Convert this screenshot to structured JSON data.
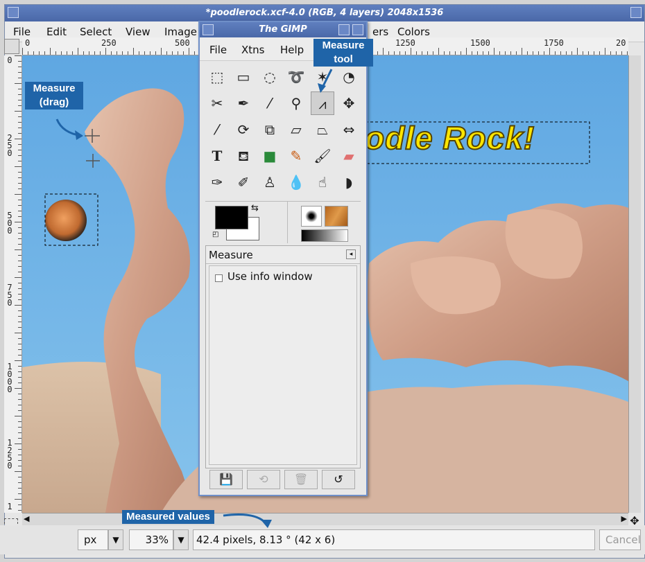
{
  "image_window": {
    "title": "*poodlerock.xcf-4.0 (RGB, 4 layers) 2048x1536",
    "menu": [
      "File",
      "Edit",
      "Select",
      "View",
      "Image",
      "ers",
      "Colors"
    ],
    "hruler_labels": [
      "0",
      "250",
      "500",
      "1250",
      "1500",
      "1750",
      "20"
    ],
    "vruler_labels": [
      "0",
      "250",
      "500",
      "750",
      "1000",
      "1250",
      "1"
    ],
    "image_text": "odle Rock!",
    "status": {
      "unit": "px",
      "zoom": "33%",
      "message": "42.4 pixels, 8.13 ° (42 x 6)",
      "cancel": "Cancel"
    }
  },
  "toolbox": {
    "title": "The GIMP",
    "menu": [
      "File",
      "Xtns",
      "Help"
    ],
    "tool_options": {
      "title": "Measure",
      "use_info_window": "Use info window",
      "use_info_window_checked": false
    }
  },
  "callouts": {
    "measure_drag": [
      "Measure",
      "(drag)"
    ],
    "measure_tool": [
      "Measure",
      "tool"
    ],
    "measured_values": "Measured values"
  },
  "colors": {
    "titlebar": "#5877b8",
    "callout": "#1f64a8",
    "sky": "#6fb3e8",
    "rock": "#d8b09a",
    "overlay_text": "#ffe600"
  }
}
